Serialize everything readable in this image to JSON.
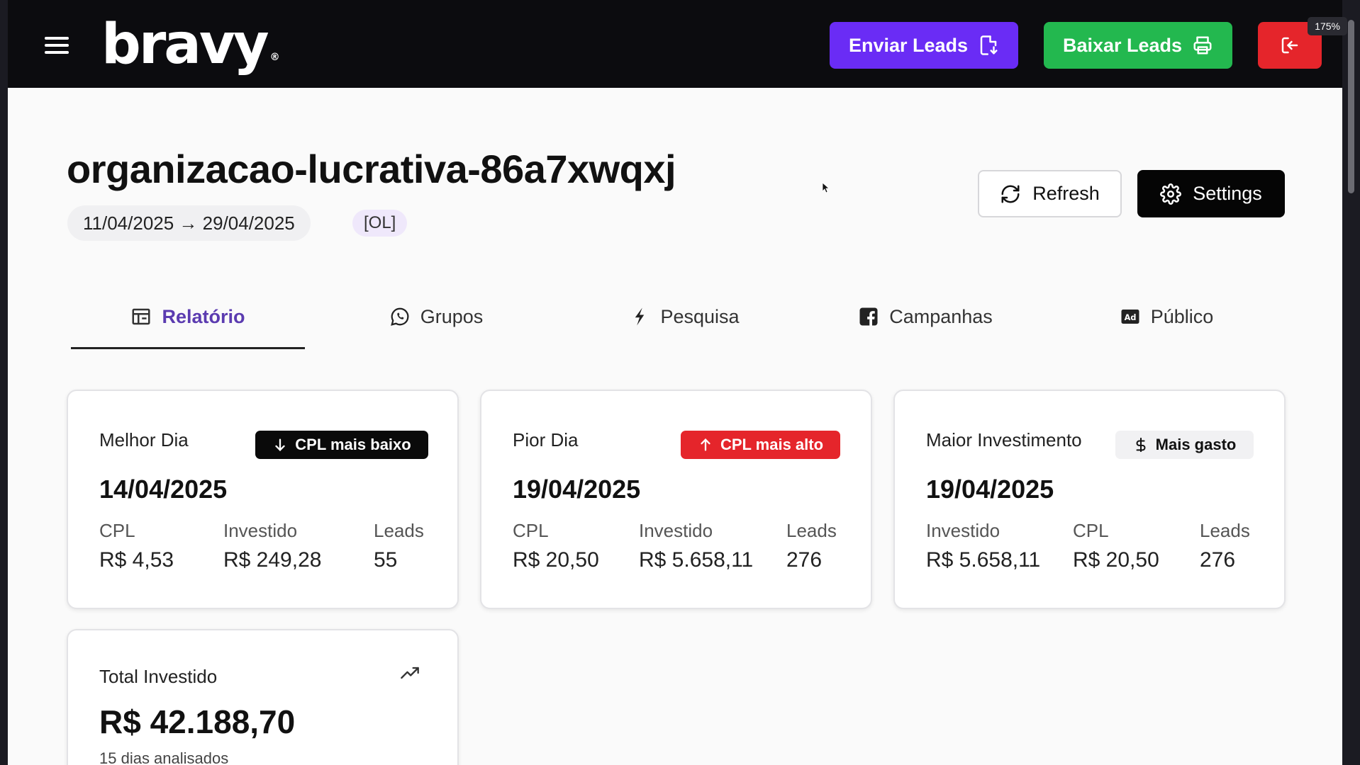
{
  "zoom_badge": "175%",
  "brand": {
    "logo": "bravy",
    "mark": "®"
  },
  "topbar": {
    "enviar_label": "Enviar Leads",
    "baixar_label": "Baixar Leads",
    "enviar_color": "#6a2cf5",
    "baixar_color": "#23b84f",
    "logout_color": "#e5252b"
  },
  "header": {
    "title": "organizacao-lucrativa-86a7xwqxj",
    "date_range": "11/04/2025 → 29/04/2025",
    "tag": "[OL]",
    "refresh_label": "Refresh",
    "settings_label": "Settings"
  },
  "tabs": [
    {
      "label": "Relatório",
      "icon": "report-icon",
      "active": true
    },
    {
      "label": "Grupos",
      "icon": "whatsapp-icon",
      "active": false
    },
    {
      "label": "Pesquisa",
      "icon": "lightning-icon",
      "active": false
    },
    {
      "label": "Campanhas",
      "icon": "facebook-icon",
      "active": false
    },
    {
      "label": "Público",
      "icon": "ad-icon",
      "active": false
    }
  ],
  "cards": {
    "best": {
      "label": "Melhor Dia",
      "badge": "CPL mais baixo",
      "date": "14/04/2025",
      "stats": [
        {
          "label": "CPL",
          "value": "R$ 4,53"
        },
        {
          "label": "Investido",
          "value": "R$ 249,28"
        },
        {
          "label": "Leads",
          "value": "55"
        }
      ]
    },
    "worst": {
      "label": "Pior Dia",
      "badge": "CPL mais alto",
      "date": "19/04/2025",
      "stats": [
        {
          "label": "CPL",
          "value": "R$ 20,50"
        },
        {
          "label": "Investido",
          "value": "R$ 5.658,11"
        },
        {
          "label": "Leads",
          "value": "276"
        }
      ]
    },
    "biggest": {
      "label": "Maior Investimento",
      "badge": "Mais gasto",
      "date": "19/04/2025",
      "stats": [
        {
          "label": "Investido",
          "value": "R$ 5.658,11"
        },
        {
          "label": "CPL",
          "value": "R$ 20,50"
        },
        {
          "label": "Leads",
          "value": "276"
        }
      ]
    },
    "total": {
      "label": "Total Investido",
      "value": "R$ 42.188,70",
      "subtitle": "15 dias analisados"
    }
  }
}
